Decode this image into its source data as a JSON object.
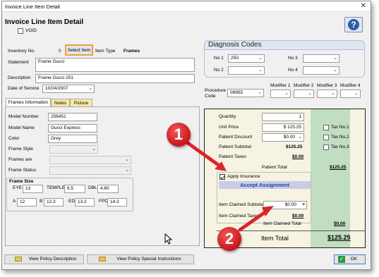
{
  "window": {
    "title": "Invoice Line Item Detail",
    "heading": "Invoice Line Item Detail",
    "void_label": "VOID"
  },
  "inventory": {
    "label": "Inventory No.",
    "value": "0",
    "select_button": "Select Item",
    "item_type_label": "Item Type",
    "item_type_value": "Frames"
  },
  "statement": {
    "label": "Statement",
    "value": "Frame Gucci"
  },
  "description": {
    "label": "Description",
    "value": "Frame Gucci 251"
  },
  "date_of_service": {
    "label": "Date of Service",
    "value": "10/24/2007"
  },
  "tabs": [
    "Frames Information",
    "Notes",
    "Picture"
  ],
  "frames": {
    "model_number": {
      "label": "Model Number",
      "value": "256451"
    },
    "model_name": {
      "label": "Model Name",
      "value": "Gucci Express"
    },
    "color": {
      "label": "Color",
      "value": "Grey"
    },
    "frame_style": {
      "label": "Frame Style",
      "value": ""
    },
    "frames_are": {
      "label": "Frames are",
      "value": ""
    },
    "frame_status": {
      "label": "Frame Status",
      "value": ""
    }
  },
  "frame_size": {
    "title": "Frame Size",
    "eye_label": "EYE",
    "eye": "13",
    "temple_label": "TEMPLE",
    "temple": "6.5",
    "dbl_label": "DBL",
    "dbl": "4.60",
    "a_label": "A",
    "a": "12",
    "b_label": "B",
    "b": "12.3",
    "ed_label": "ED",
    "ed": "13.2",
    "fpd_label": "FPD",
    "fpd": "14.3"
  },
  "diagnosis": {
    "title": "Diagnosis Codes",
    "no1_label": "No 1",
    "no1": "250.",
    "no2_label": "No 2",
    "no2": "",
    "no3_label": "No 3",
    "no3": "",
    "no4_label": "No 4",
    "no4": ""
  },
  "procedure": {
    "label": "Procedure Code",
    "value": "09955",
    "modifier_labels": [
      "Modifier 1",
      "Modifier 2",
      "Modifier 3",
      "Modifier 4"
    ]
  },
  "pricing": {
    "quantity_label": "Quantity",
    "quantity": "1",
    "unit_price_label": "Unit Price",
    "unit_price": "$ 125.25",
    "discount_label": "Patient Discount",
    "discount": "$0.00",
    "subtotal_label": "Patient Subtotal",
    "subtotal": "$125.25",
    "taxes_label": "Patient Taxes",
    "taxes": "$0.00",
    "tax1": "Tax No.1",
    "tax2": "Tax No.2",
    "tax3": "Tax No.3",
    "patient_total_label": "Patient Total",
    "patient_total": "$125.25",
    "apply_insurance_label": "Apply Insurance",
    "accept_assignment": "Accept Assignment",
    "claimed_subtotal_label": "Item Claimed Subtotal",
    "claimed_subtotal": "$0.00",
    "claimed_taxes_label": "Item Claimed Taxes",
    "claimed_taxes": "$0.00",
    "claimed_total_label": "Item Claimed Total",
    "claimed_total": "$0.00",
    "item_total_label": "Item Total",
    "item_total": "$125.25"
  },
  "footer": {
    "view_policy": "View Policy Description",
    "view_special": "View Policy Special Instructions",
    "ok": "OK"
  },
  "callouts": {
    "one": "1",
    "two": "2"
  },
  "colors": {
    "accent_red": "#d9262c",
    "total_green": "#c2dec2",
    "assignment_bar": "#c8cde6",
    "panel_bg": "#f7f3e2"
  }
}
